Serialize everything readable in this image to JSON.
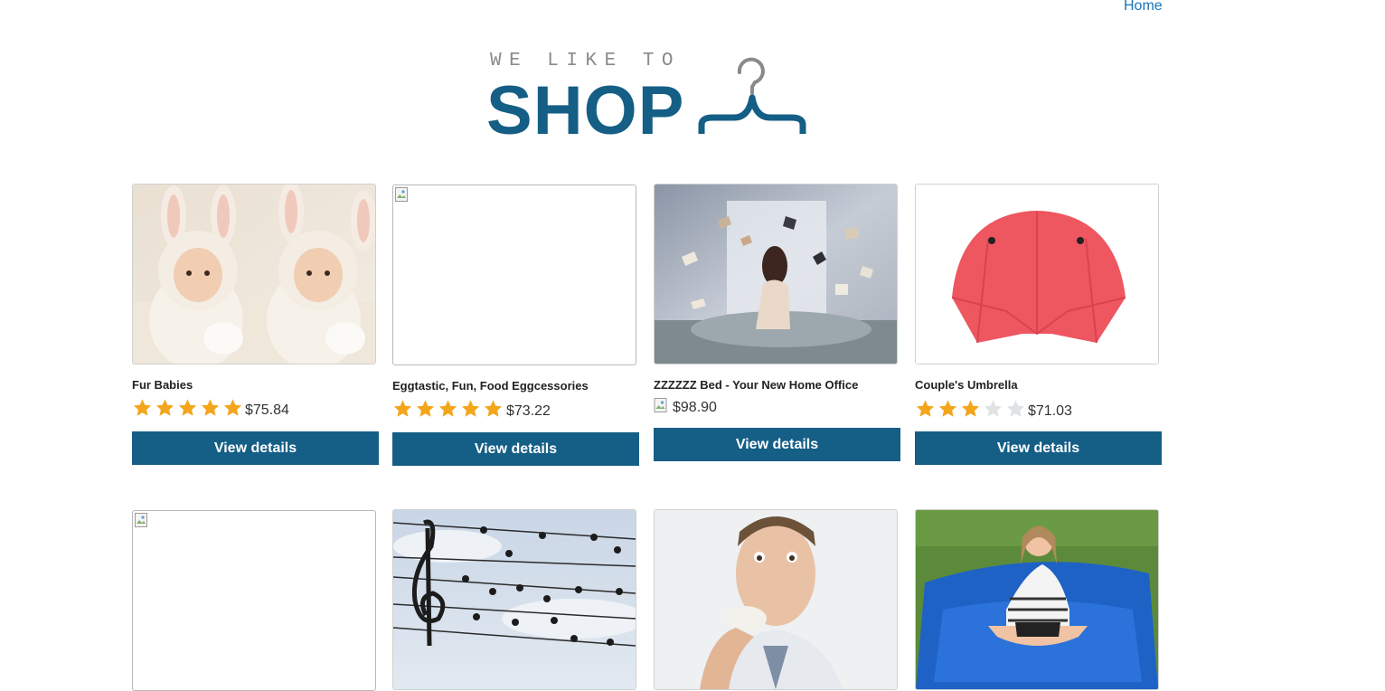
{
  "nav": {
    "home_label": "Home"
  },
  "logo": {
    "tagline": "WE LIKE TO",
    "brand": "SHOP",
    "icon": "hanger-icon",
    "brand_color": "#155e86"
  },
  "colors": {
    "accent": "#155e86",
    "star_filled": "#f3a61c",
    "star_empty": "#dfe3e6",
    "link": "#1874b8"
  },
  "products": [
    {
      "title": "Fur Babies",
      "rating": 5,
      "price": "$75.84",
      "button": "View details",
      "image": "photo"
    },
    {
      "title": "Eggtastic, Fun, Food Eggcessories",
      "rating": 5,
      "price": "$73.22",
      "button": "View details",
      "image": "broken"
    },
    {
      "title": "ZZZZZZ Bed - Your New Home Office",
      "rating": null,
      "price": "$98.90",
      "button": "View details",
      "image": "photo"
    },
    {
      "title": "Couple's Umbrella",
      "rating": 3,
      "price": "$71.03",
      "button": "View details",
      "image": "photo"
    },
    {
      "image": "broken"
    },
    {
      "image": "photo"
    },
    {
      "image": "photo"
    },
    {
      "image": "photo"
    }
  ]
}
